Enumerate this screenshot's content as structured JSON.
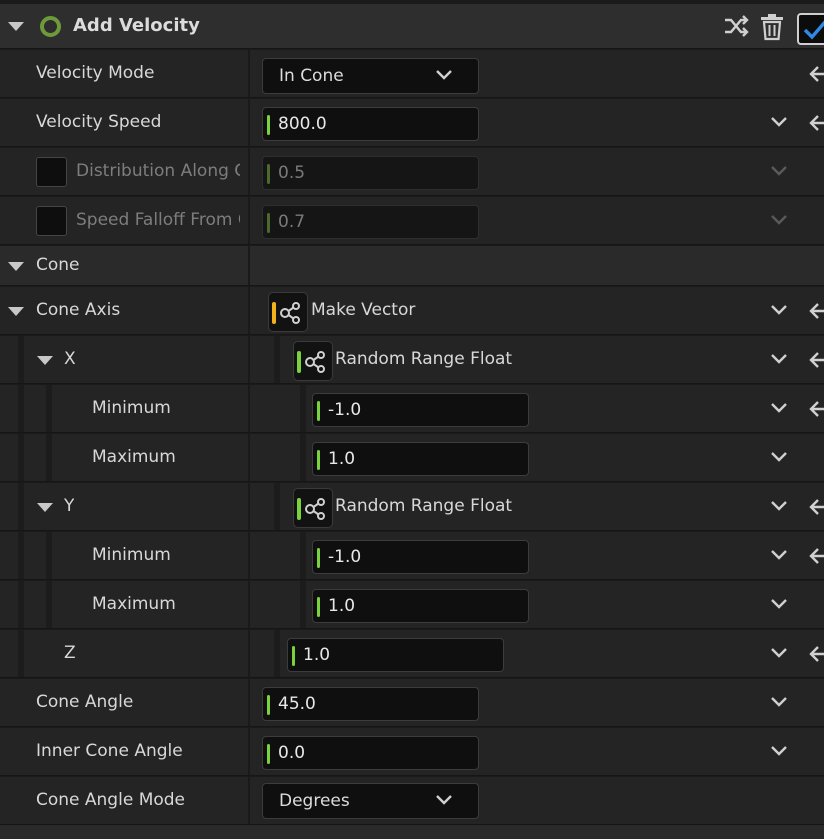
{
  "header": {
    "title": "Add Velocity",
    "enabled": true
  },
  "colors": {
    "accent_green": "#7ad23c",
    "accent_yellow": "#f2b21c",
    "check_blue": "#2f8ae6",
    "module_ring": "#6f9a3a"
  },
  "rows": {
    "velocity_mode": {
      "label": "Velocity Mode",
      "value": "In Cone"
    },
    "velocity_speed": {
      "label": "Velocity Speed",
      "value": "800.0"
    },
    "distribution": {
      "label": "Distribution Along Cone Axis",
      "value": "0.5"
    },
    "speed_falloff": {
      "label": "Speed Falloff From Cone Axis",
      "value": "0.7"
    },
    "cone_section": {
      "label": "Cone"
    },
    "cone_axis": {
      "label": "Cone Axis",
      "function": "Make Vector"
    },
    "x": {
      "label": "X",
      "function": "Random Range Float",
      "minimum_label": "Minimum",
      "minimum": "-1.0",
      "maximum_label": "Maximum",
      "maximum": "1.0"
    },
    "y": {
      "label": "Y",
      "function": "Random Range Float",
      "minimum_label": "Minimum",
      "minimum": "-1.0",
      "maximum_label": "Maximum",
      "maximum": "1.0"
    },
    "z": {
      "label": "Z",
      "value": "1.0"
    },
    "cone_angle": {
      "label": "Cone Angle",
      "value": "45.0"
    },
    "inner_cone_angle": {
      "label": "Inner Cone Angle",
      "value": "0.0"
    },
    "cone_angle_mode": {
      "label": "Cone Angle Mode",
      "value": "Degrees"
    }
  },
  "icons": {
    "expand": "triangle-down-icon",
    "module": "ring-icon",
    "shuffle": "shuffle-icon",
    "delete": "trash-icon",
    "enable": "checkmark-icon",
    "dropdown": "chevron-down-icon",
    "reset": "reset-arrow-icon",
    "function": "dynamic-input-icon"
  }
}
